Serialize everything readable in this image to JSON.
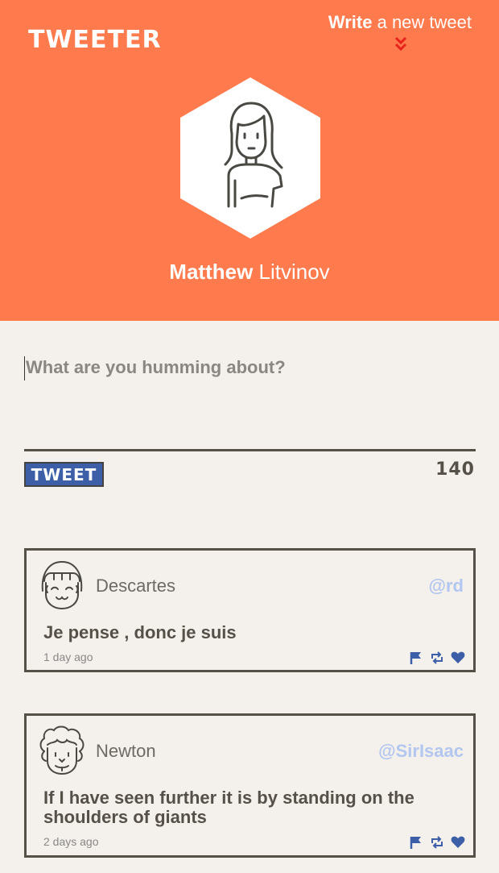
{
  "header": {
    "brand": "TWEETER",
    "write_bold": "Write",
    "write_rest": " a new tweet",
    "profile_first": "Matthew",
    "profile_last": " Litvinov"
  },
  "composer": {
    "placeholder": "What are you humming about?",
    "button_label": "TWEET",
    "char_count": "140"
  },
  "tweets": [
    {
      "name": "Descartes",
      "handle": "@rd",
      "text": "Je pense , donc je suis",
      "time": "1 day ago"
    },
    {
      "name": "Newton",
      "handle": "@SirIsaac",
      "text": "If I have seen further it is by standing on the shoulders of giants",
      "time": "2 days ago"
    }
  ],
  "colors": {
    "header_bg": "#ff7a4c",
    "page_bg": "#f4f1ec",
    "tweet_button": "#3c5fa8",
    "handle": "#b2c6f0",
    "action_icons": "#3c5fa8",
    "chevron": "#e8221b"
  },
  "icons": [
    "chevron-double-down-icon",
    "flag-icon",
    "retweet-icon",
    "heart-icon"
  ]
}
